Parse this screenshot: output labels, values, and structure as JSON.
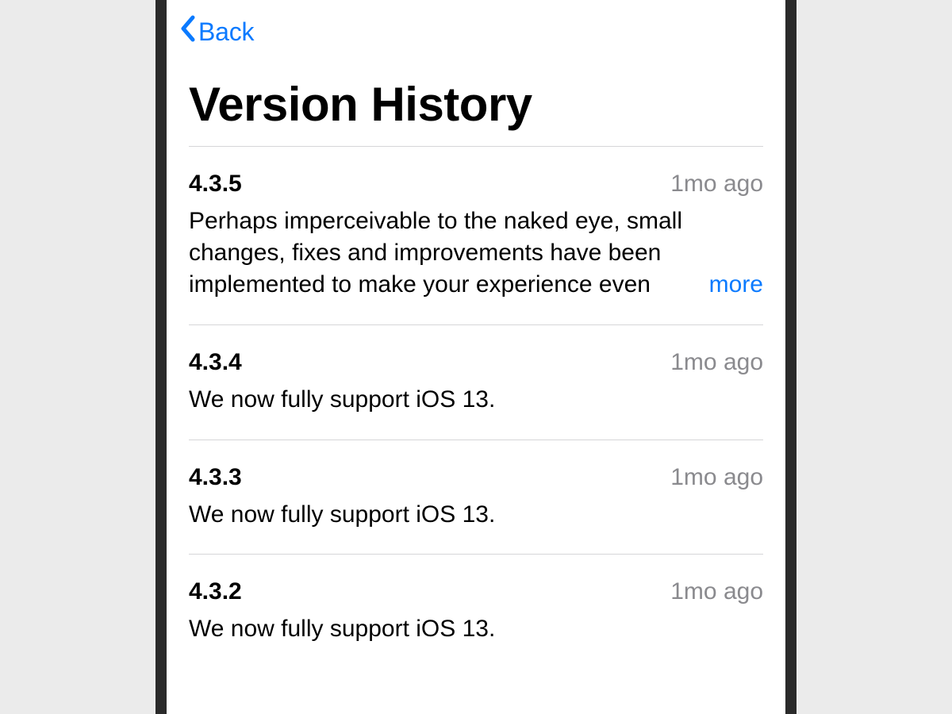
{
  "nav": {
    "back_label": "Back"
  },
  "page": {
    "title": "Version History"
  },
  "versions": [
    {
      "number": "4.3.5",
      "age": "1mo ago",
      "notes": "Perhaps imperceivable to the naked eye, small changes, fixes and improvements have been implemented to make your experience even",
      "truncated": true,
      "more_label": "more"
    },
    {
      "number": "4.3.4",
      "age": "1mo ago",
      "notes": "We now fully support iOS 13.",
      "truncated": false
    },
    {
      "number": "4.3.3",
      "age": "1mo ago",
      "notes": "We now fully support iOS 13.",
      "truncated": false
    },
    {
      "number": "4.3.2",
      "age": "1mo ago",
      "notes": "We now fully support iOS 13.",
      "truncated": false
    }
  ],
  "colors": {
    "link": "#0a7aff",
    "secondary_text": "#8a8a8e",
    "divider": "#d6d6d8"
  }
}
